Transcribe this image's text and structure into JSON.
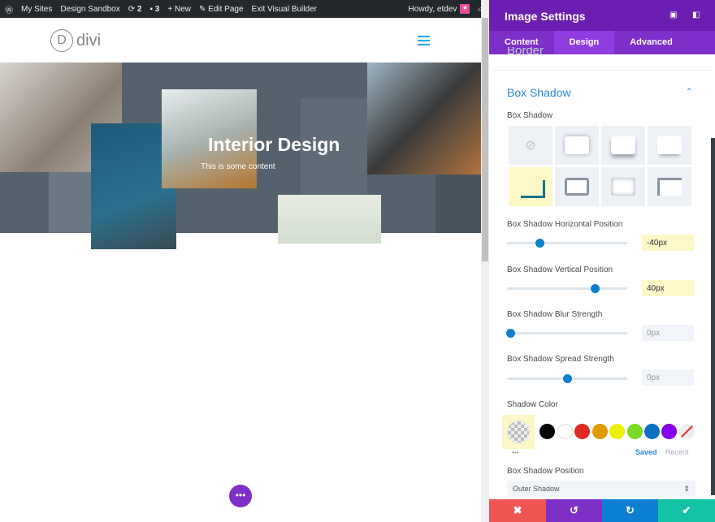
{
  "adminbar": {
    "items": [
      "My Sites",
      "Design Sandbox",
      "2",
      "3",
      "New",
      "Edit Page",
      "Exit Visual Builder"
    ],
    "howdy": "Howdy, etdev"
  },
  "site": {
    "logo_letter": "D",
    "logo_text": "divi"
  },
  "hero": {
    "title": "Interior Design",
    "content": "This is some content"
  },
  "panel": {
    "title": "Image Settings",
    "tabs": [
      "Content",
      "Design",
      "Advanced"
    ],
    "active_tab": "Design",
    "collapsed_section": "Border",
    "section": "Box Shadow",
    "box_shadow_label": "Box Shadow",
    "selected_preset": 5,
    "sliders": [
      {
        "label": "Box Shadow Horizontal Position",
        "value": "-40px",
        "fraction": 0.27
      },
      {
        "label": "Box Shadow Vertical Position",
        "value": "40px",
        "fraction": 0.73
      },
      {
        "label": "Box Shadow Blur Strength",
        "value": "0px",
        "fraction": 0.03
      },
      {
        "label": "Box Shadow Spread Strength",
        "value": "0px",
        "fraction": 0.5
      }
    ],
    "shadow_color_label": "Shadow Color",
    "swatches": [
      "#000000",
      "#ffffff",
      "#e02b20",
      "#e09900",
      "#edf000",
      "#7cda24",
      "#0c71c3",
      "#8300e9"
    ],
    "saved": "Saved",
    "recent": "Recent",
    "more": "•••",
    "position_label": "Box Shadow Position",
    "position_value": "Outer Shadow"
  },
  "footer": {
    "colors": [
      "#ef5555",
      "#7e30c6",
      "#0c7fd0",
      "#14c3a3"
    ]
  }
}
